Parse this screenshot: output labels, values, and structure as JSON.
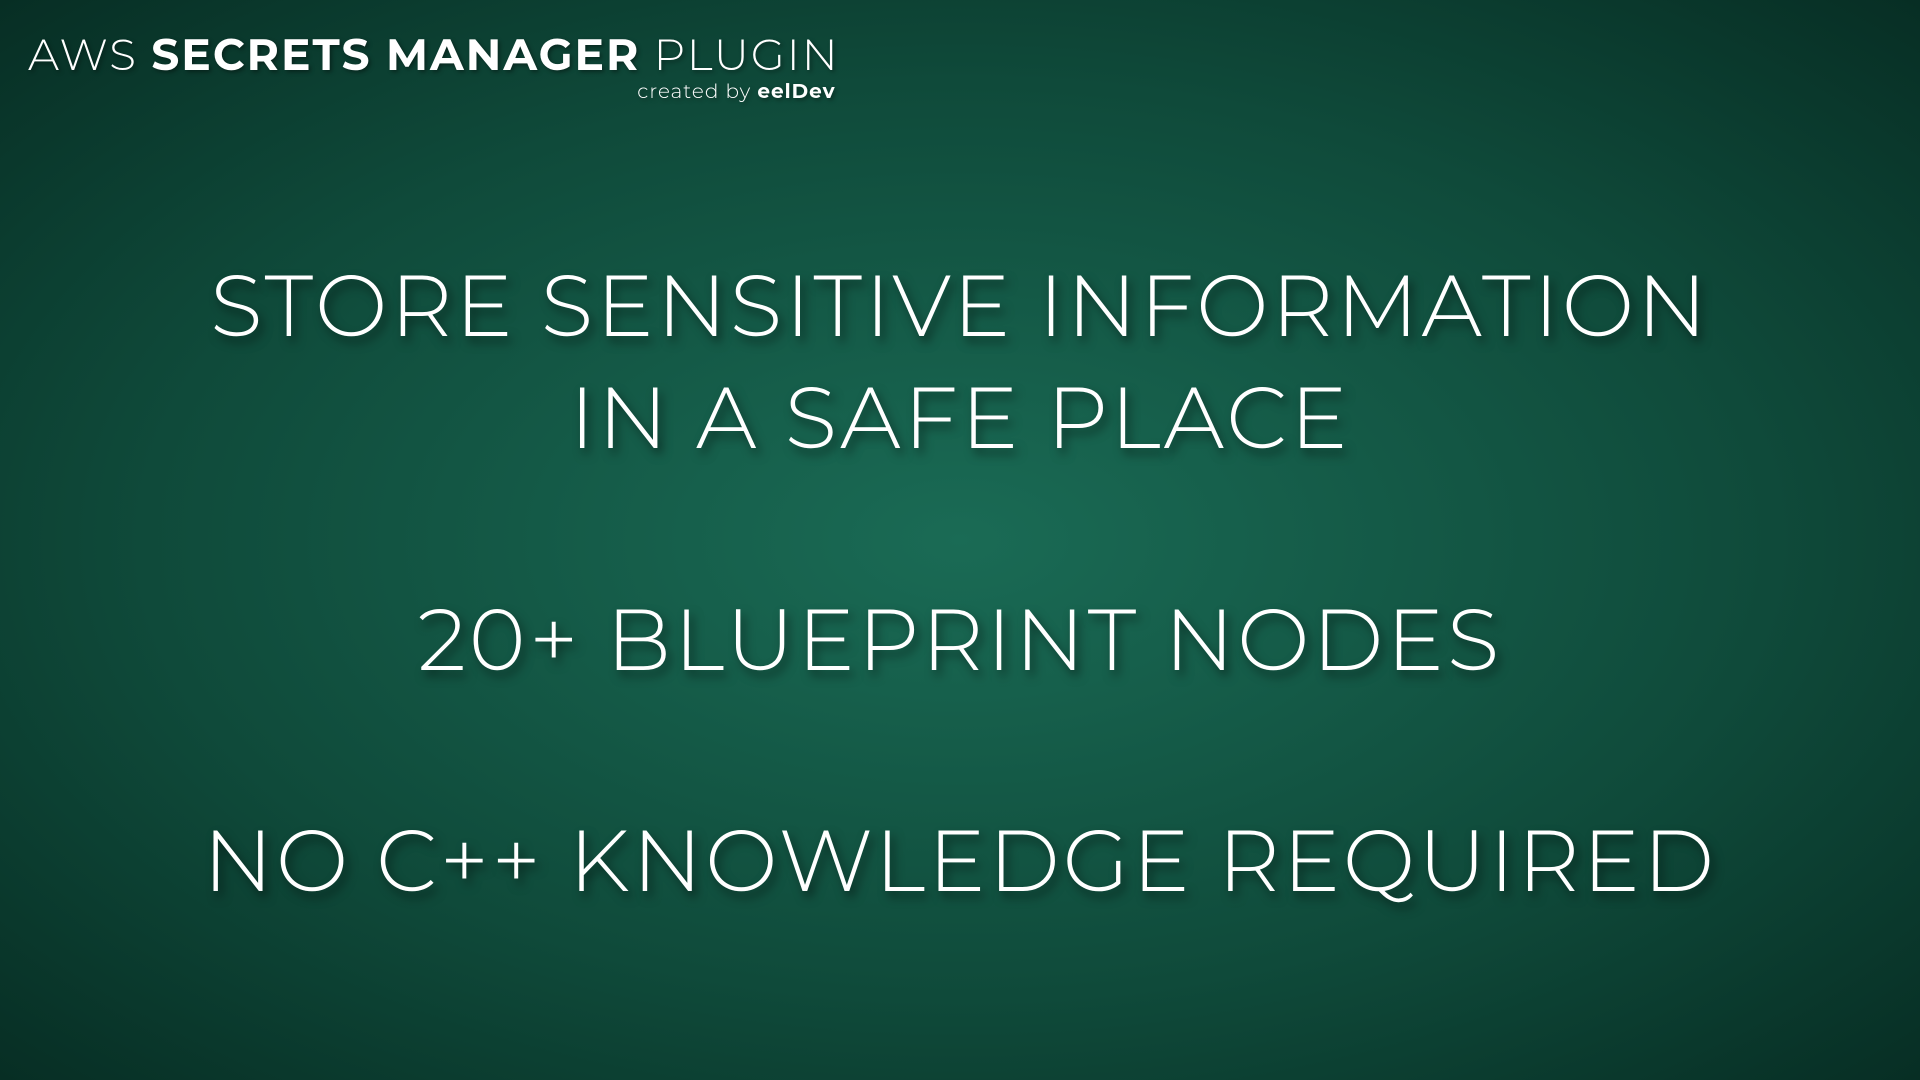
{
  "header": {
    "title_part1": "AWS ",
    "title_part2": "SECRETS MANAGER",
    "title_part3": " PLUGIN",
    "subtitle_prefix": "created by ",
    "subtitle_brand": "eelDev"
  },
  "features": {
    "line1": "STORE SENSITIVE INFORMATION",
    "line2": "IN A SAFE PLACE",
    "line3": "20+ BLUEPRINT NODES",
    "line4": "NO C++ KNOWLEDGE REQUIRED"
  }
}
